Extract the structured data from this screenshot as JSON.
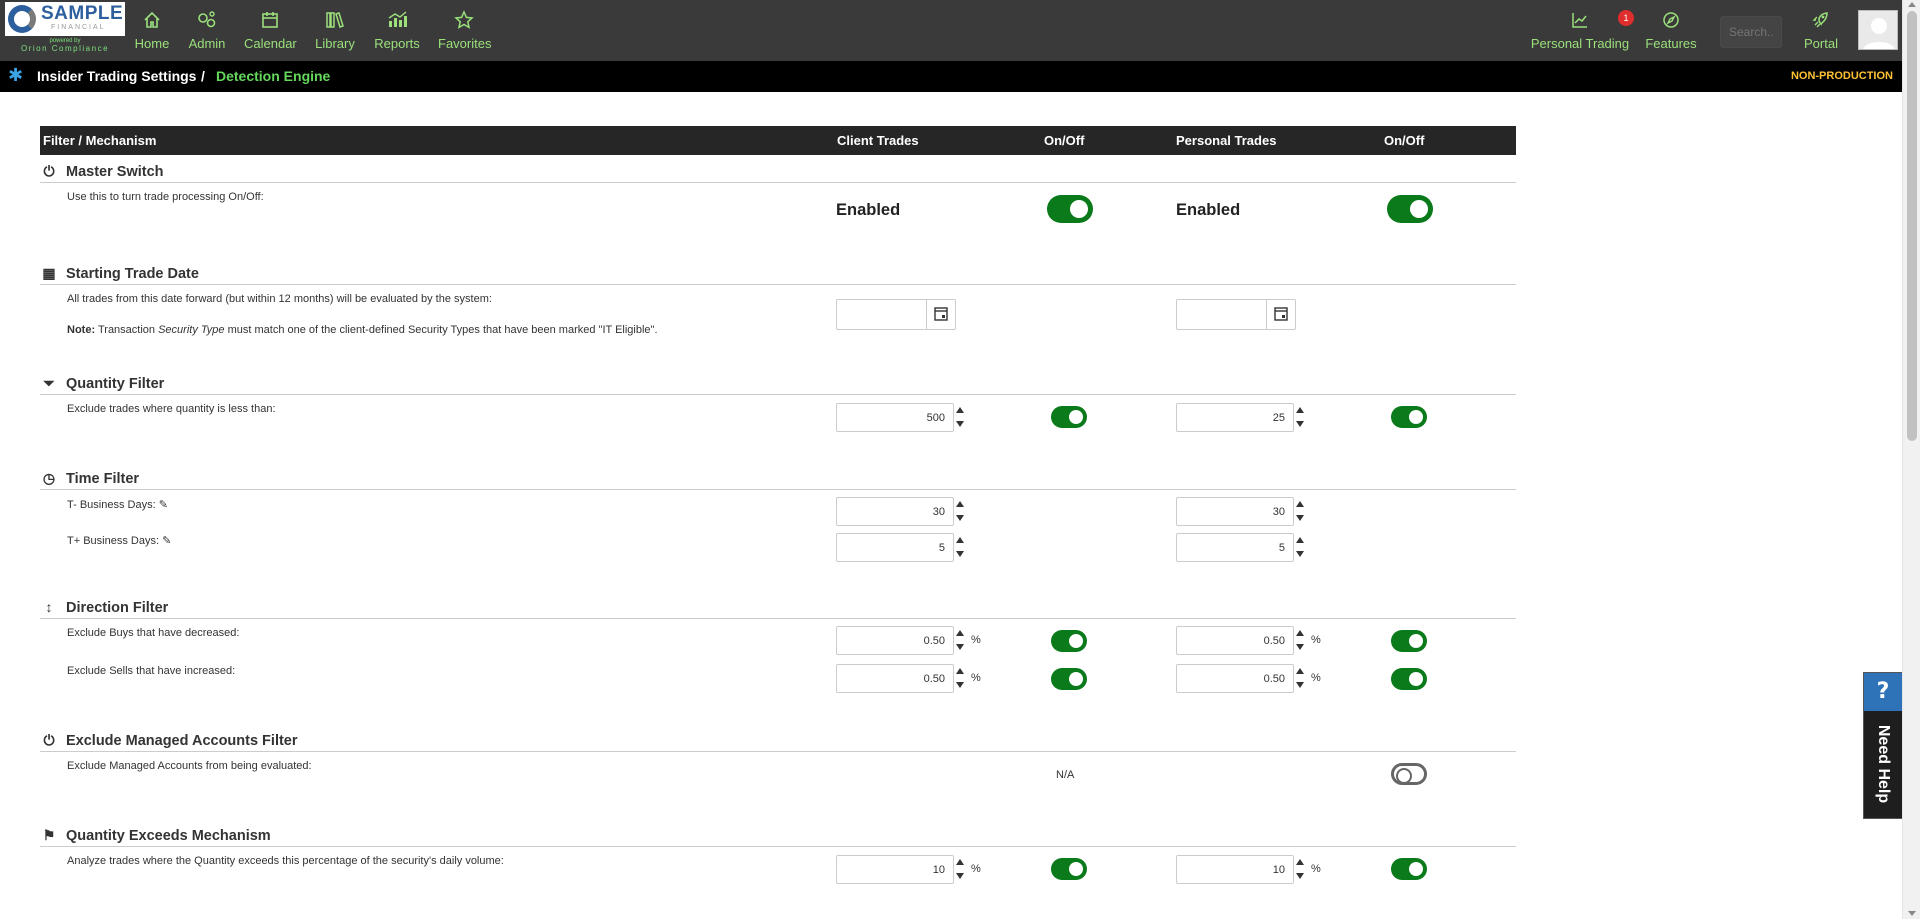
{
  "logo": {
    "name": "SAMPLE",
    "sub": "FINANCIAL",
    "powered": "powered by",
    "company": "Orion Compliance"
  },
  "nav": {
    "home": "Home",
    "admin": "Admin",
    "calendar": "Calendar",
    "library": "Library",
    "reports": "Reports",
    "favorites": "Favorites",
    "personal_trading": "Personal Trading",
    "personal_trading_badge": "1",
    "features": "Features",
    "search_placeholder": "Search..",
    "portal": "Portal"
  },
  "breadcrumb": {
    "parent": "Insider Trading Settings",
    "sep": "/",
    "current": "Detection Engine",
    "env": "NON-PRODUCTION"
  },
  "table": {
    "headers": {
      "filter": "Filter / Mechanism",
      "client": "Client Trades",
      "client_onoff": "On/Off",
      "personal": "Personal Trades",
      "personal_onoff": "On/Off"
    }
  },
  "sections": {
    "master": {
      "title": "Master Switch",
      "desc": "Use this to turn trade processing On/Off:",
      "client_status": "Enabled",
      "personal_status": "Enabled",
      "client_on": true,
      "personal_on": true
    },
    "start_date": {
      "title": "Starting Trade Date",
      "desc": "All trades from this date forward (but within 12 months) will be evaluated by the system:",
      "note_label": "Note:",
      "note_pre": " Transaction ",
      "note_italic": "Security Type",
      "note_post": " must match one of the client-defined Security Types that have been marked \"IT Eligible\".",
      "client_value": "",
      "personal_value": ""
    },
    "quantity": {
      "title": "Quantity Filter",
      "desc": "Exclude trades where quantity is less than:",
      "client_value": "500",
      "personal_value": "25",
      "client_on": true,
      "personal_on": true
    },
    "time": {
      "title": "Time Filter",
      "t_minus_label": "T- Business Days:",
      "t_plus_label": "T+ Business Days:",
      "client_t_minus": "30",
      "personal_t_minus": "30",
      "client_t_plus": "5",
      "personal_t_plus": "5"
    },
    "direction": {
      "title": "Direction Filter",
      "buys_label": "Exclude Buys that have decreased:",
      "sells_label": "Exclude Sells that have increased:",
      "client_buys": "0.50",
      "personal_buys": "0.50",
      "client_sells": "0.50",
      "personal_sells": "0.50",
      "unit": "%",
      "client_buys_on": true,
      "personal_buys_on": true,
      "client_sells_on": true,
      "personal_sells_on": true
    },
    "managed": {
      "title": "Exclude Managed Accounts Filter",
      "desc": "Exclude Managed Accounts from being evaluated:",
      "client_na": "N/A",
      "personal_on": false
    },
    "qty_exceeds": {
      "title": "Quantity Exceeds Mechanism",
      "desc": "Analyze trades where the Quantity exceeds this percentage of the security's daily volume:",
      "client_value": "10",
      "personal_value": "10",
      "unit": "%",
      "client_on": true,
      "personal_on": true
    }
  },
  "help": {
    "icon": "?",
    "label": "Need Help"
  },
  "colors": {
    "accent_green": "#9be07b",
    "toggle_green": "#0a7a1a",
    "breadcrumb_green": "#63d85a",
    "nonprod": "#ffc233",
    "help_blue": "#2e73b8"
  }
}
